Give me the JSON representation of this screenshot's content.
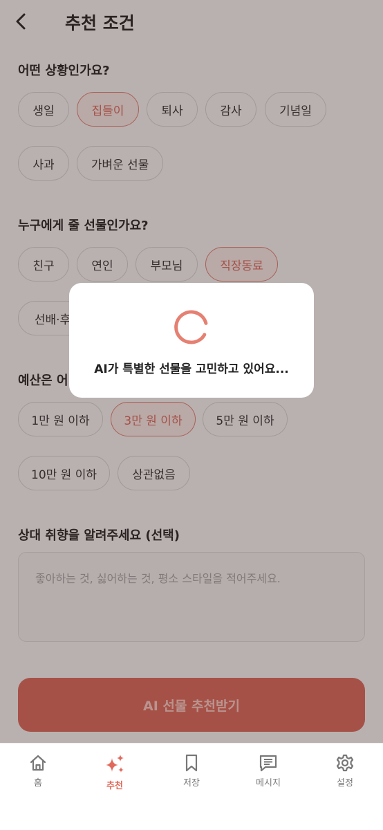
{
  "header": {
    "title": "추천 조건"
  },
  "occasion": {
    "title": "어떤 상황인가요?",
    "options": [
      "생일",
      "집들이",
      "퇴사",
      "감사",
      "기념일",
      "사과",
      "가벼운 선물"
    ],
    "selected": "집들이"
  },
  "recipient": {
    "title": "누구에게 줄 선물인가요?",
    "options": [
      "친구",
      "연인",
      "부모님",
      "직장동료",
      "선배·후"
    ],
    "selected": "직장동료"
  },
  "budget": {
    "title": "예산은 어",
    "options": [
      "1만 원 이하",
      "3만 원 이하",
      "5만 원 이하",
      "10만 원 이하",
      "상관없음"
    ],
    "selected": "3만 원 이하"
  },
  "preference": {
    "title": "상대 취향을 알려주세요 (선택)",
    "placeholder": "좋아하는 것, 싫어하는 것, 평소 스타일을 적어주세요."
  },
  "cta": {
    "label": "AI 선물 추천받기"
  },
  "loading": {
    "message": "AI가 특별한 선물을 고민하고 있어요..."
  },
  "nav": {
    "items": [
      {
        "label": "홈",
        "icon": "home-icon"
      },
      {
        "label": "추천",
        "icon": "sparkle-icon"
      },
      {
        "label": "저장",
        "icon": "bookmark-icon"
      },
      {
        "label": "메시지",
        "icon": "message-icon"
      },
      {
        "label": "설정",
        "icon": "settings-icon"
      }
    ],
    "active": "추천"
  },
  "colors": {
    "accent": "#e0695b",
    "chip_border": "#d9d9d9",
    "overlay": "#3c2824"
  }
}
